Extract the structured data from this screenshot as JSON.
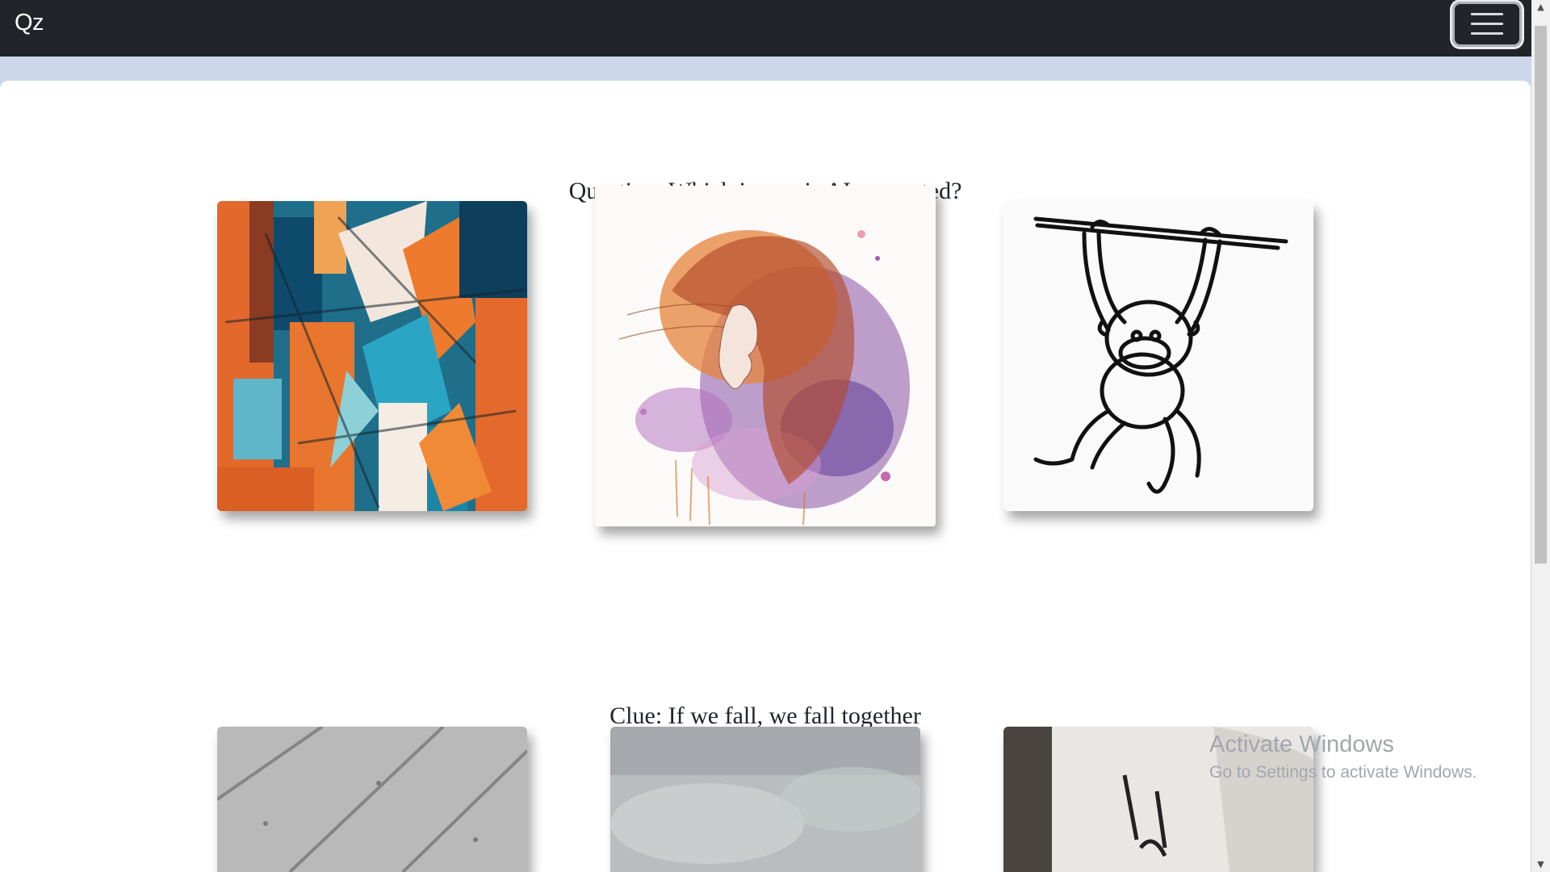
{
  "navbar": {
    "brand": "Qz",
    "toggler_icon": "hamburger-menu-icon"
  },
  "quiz": {
    "question": "Question: Which image is AI generated?",
    "clue": "Clue: If we fall, we fall together"
  },
  "images": [
    {
      "subject": "abstract-painting"
    },
    {
      "subject": "watercolor-woman-portrait"
    },
    {
      "subject": "monkey-line-drawing"
    },
    {
      "subject": "gray-textured-surface"
    },
    {
      "subject": "gray-stone-texture"
    },
    {
      "subject": "dark-room-photo"
    }
  ],
  "watermark": {
    "title": "Activate Windows",
    "subtitle": "Go to Settings to activate Windows."
  },
  "colors": {
    "navbar_bg": "#212529",
    "page_band": "#cdd7ea",
    "content_bg": "#ffffff",
    "text": "#212529",
    "watermark": "#a3a6ab"
  }
}
